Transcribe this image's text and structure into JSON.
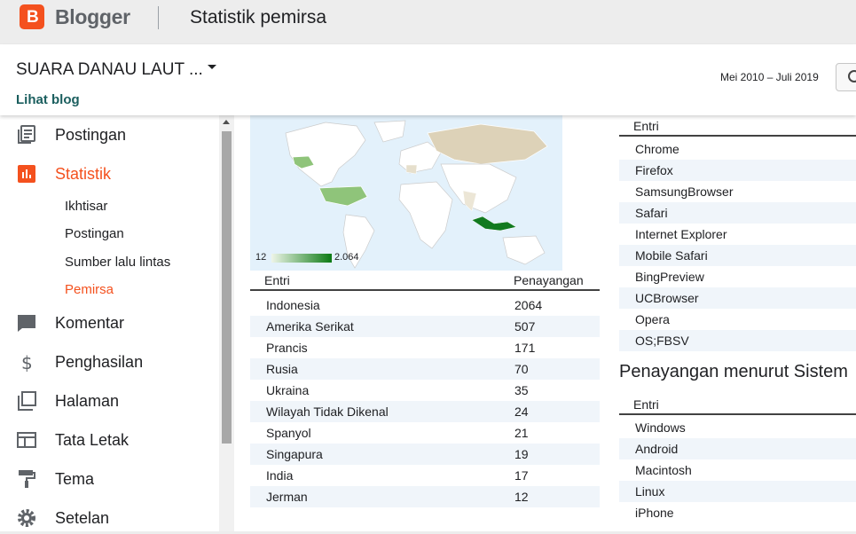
{
  "header": {
    "brand": "Blogger",
    "logo_letter": "B",
    "page_title": "Statistik pemirsa"
  },
  "subheader": {
    "blog_name": "SUARA DANAU LAUT ...",
    "view_blog": "Lihat blog",
    "date_range": "Mei 2010 – Juli 2019"
  },
  "sidebar": {
    "items": [
      {
        "label": "Postingan",
        "icon": "posts-icon"
      },
      {
        "label": "Statistik",
        "icon": "stats-icon"
      },
      {
        "label": "Komentar",
        "icon": "comment-icon"
      },
      {
        "label": "Penghasilan",
        "icon": "dollar-icon"
      },
      {
        "label": "Halaman",
        "icon": "pages-icon"
      },
      {
        "label": "Tata Letak",
        "icon": "layout-icon"
      },
      {
        "label": "Tema",
        "icon": "paint-roller-icon"
      },
      {
        "label": "Setelan",
        "icon": "gear-icon"
      }
    ],
    "subitems": [
      "Ikhtisar",
      "Postingan",
      "Sumber lalu lintas",
      "Pemirsa"
    ],
    "active_subitem": "Pemirsa",
    "accent_color": "#f4511e"
  },
  "map": {
    "legend_min": "12",
    "legend_max": "2.064"
  },
  "countries": {
    "header_entry": "Entri",
    "header_views": "Penayangan",
    "rows": [
      {
        "name": "Indonesia",
        "views": "2064"
      },
      {
        "name": "Amerika Serikat",
        "views": "507"
      },
      {
        "name": "Prancis",
        "views": "171"
      },
      {
        "name": "Rusia",
        "views": "70"
      },
      {
        "name": "Ukraina",
        "views": "35"
      },
      {
        "name": "Wilayah Tidak Dikenal",
        "views": "24"
      },
      {
        "name": "Spanyol",
        "views": "21"
      },
      {
        "name": "Singapura",
        "views": "19"
      },
      {
        "name": "India",
        "views": "17"
      },
      {
        "name": "Jerman",
        "views": "12"
      }
    ]
  },
  "browsers": {
    "header_entry": "Entri",
    "rows": [
      "Chrome",
      "Firefox",
      "SamsungBrowser",
      "Safari",
      "Internet Explorer",
      "Mobile Safari",
      "BingPreview",
      "UCBrowser",
      "Opera",
      "OS;FBSV"
    ]
  },
  "os": {
    "title": "Penayangan menurut Sistem",
    "header_entry": "Entri",
    "rows": [
      "Windows",
      "Android",
      "Macintosh",
      "Linux",
      "iPhone"
    ]
  }
}
